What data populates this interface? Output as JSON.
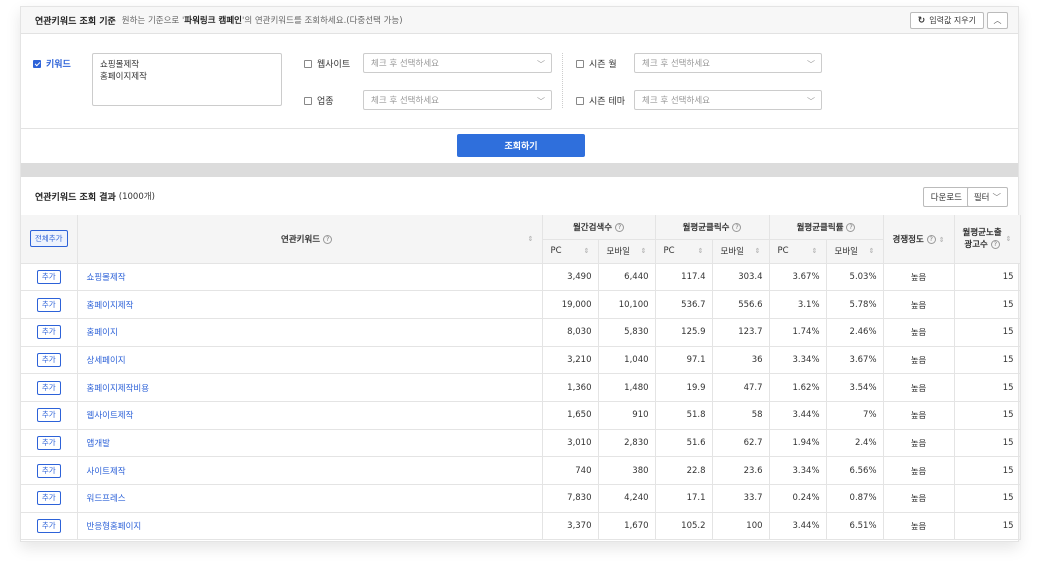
{
  "criteria": {
    "title": "연관키워드 조회 기준",
    "desc_prefix": "원하는 기준으로 '",
    "desc_bold": "파워링크 캠페인",
    "desc_suffix": "'의 연관키워드를 조회하세요.(다중선택 가능)",
    "reset_label": "입력값 지우기",
    "keyword_label": "키워드",
    "keyword_value": "쇼핑몰제작\n홈페이지제작",
    "website_label": "웹사이트",
    "industry_label": "업종",
    "season_month_label": "시즌 월",
    "season_theme_label": "시즌 테마",
    "select_placeholder": "체크 후 선택하세요",
    "search_label": "조회하기"
  },
  "results": {
    "title": "연관키워드 조회 결과",
    "count": "(1000개)",
    "download_label": "다운로드",
    "filter_label": "필터",
    "add_all_label": "전체추가",
    "add_label": "추가",
    "columns": {
      "keyword": "연관키워드",
      "monthly_search": "월간검색수",
      "avg_clicks": "월평균클릭수",
      "avg_ctr": "월평균클릭률",
      "competition": "경쟁정도",
      "avg_ads_line1": "월평균노출",
      "avg_ads_line2": "광고수",
      "pc": "PC",
      "mobile": "모바일"
    },
    "rows": [
      {
        "keyword": "쇼핑몰제작",
        "s_pc": "3,490",
        "s_mo": "6,440",
        "c_pc": "117.4",
        "c_mo": "303.4",
        "r_pc": "3.67%",
        "r_mo": "5.03%",
        "comp": "높음",
        "ads": "15"
      },
      {
        "keyword": "홈페이지제작",
        "s_pc": "19,000",
        "s_mo": "10,100",
        "c_pc": "536.7",
        "c_mo": "556.6",
        "r_pc": "3.1%",
        "r_mo": "5.78%",
        "comp": "높음",
        "ads": "15"
      },
      {
        "keyword": "홈페이지",
        "s_pc": "8,030",
        "s_mo": "5,830",
        "c_pc": "125.9",
        "c_mo": "123.7",
        "r_pc": "1.74%",
        "r_mo": "2.46%",
        "comp": "높음",
        "ads": "15"
      },
      {
        "keyword": "상세페이지",
        "s_pc": "3,210",
        "s_mo": "1,040",
        "c_pc": "97.1",
        "c_mo": "36",
        "r_pc": "3.34%",
        "r_mo": "3.67%",
        "comp": "높음",
        "ads": "15"
      },
      {
        "keyword": "홈페이지제작비용",
        "s_pc": "1,360",
        "s_mo": "1,480",
        "c_pc": "19.9",
        "c_mo": "47.7",
        "r_pc": "1.62%",
        "r_mo": "3.54%",
        "comp": "높음",
        "ads": "15"
      },
      {
        "keyword": "웹사이트제작",
        "s_pc": "1,650",
        "s_mo": "910",
        "c_pc": "51.8",
        "c_mo": "58",
        "r_pc": "3.44%",
        "r_mo": "7%",
        "comp": "높음",
        "ads": "15"
      },
      {
        "keyword": "앱개발",
        "s_pc": "3,010",
        "s_mo": "2,830",
        "c_pc": "51.6",
        "c_mo": "62.7",
        "r_pc": "1.94%",
        "r_mo": "2.4%",
        "comp": "높음",
        "ads": "15"
      },
      {
        "keyword": "사이트제작",
        "s_pc": "740",
        "s_mo": "380",
        "c_pc": "22.8",
        "c_mo": "23.6",
        "r_pc": "3.34%",
        "r_mo": "6.56%",
        "comp": "높음",
        "ads": "15"
      },
      {
        "keyword": "워드프레스",
        "s_pc": "7,830",
        "s_mo": "4,240",
        "c_pc": "17.1",
        "c_mo": "33.7",
        "r_pc": "0.24%",
        "r_mo": "0.87%",
        "comp": "높음",
        "ads": "15"
      },
      {
        "keyword": "반응형홈페이지",
        "s_pc": "3,370",
        "s_mo": "1,670",
        "c_pc": "105.2",
        "c_mo": "100",
        "r_pc": "3.44%",
        "r_mo": "6.51%",
        "comp": "높음",
        "ads": "15"
      }
    ]
  },
  "icons": {
    "reset": "refresh-icon",
    "collapse": "chevron-up-icon",
    "select": "chevron-down-icon",
    "help": "question-circle-icon",
    "sort": "sort-icon"
  },
  "colors": {
    "accent": "#2d62d8",
    "search_button": "#2f6fdc"
  }
}
